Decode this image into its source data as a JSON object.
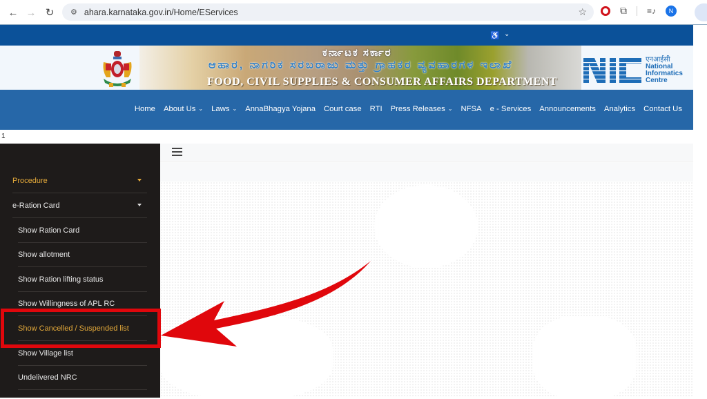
{
  "browser": {
    "url": "ahara.karnataka.gov.in/Home/EServices",
    "back_icon": "arrow-left-icon",
    "forward_icon": "arrow-right-icon",
    "reload_icon": "reload-icon",
    "site_info_icon": "tune-icon",
    "bookmark_icon": "star-icon",
    "extensions": [
      "opera-adblock-icon",
      "puzzle-icon",
      "media-control-icon"
    ],
    "profile_initial": "N"
  },
  "topbar": {
    "accessibility_icon": "accessibility-icon",
    "accessibility_glyph": "♿",
    "chevron": "⌄"
  },
  "banner": {
    "kannada_line1": "ಕರ್ನಾಟಕ ಸರ್ಕಾರ",
    "kannada_line2": "ಆಹಾರ, ನಾಗರಿಕ ಸರಬರಾಜು ಮತ್ತು ಗ್ರಾಹಕರ ವ್ಯವಹಾರಗಳ ಇಲಾಖೆ",
    "english_line": "FOOD, CIVIL SUPPLIES & CONSUMER AFFAIRS DEPARTMENT",
    "nic_hindi": "एनआईसी",
    "nic_line1": "National",
    "nic_line2": "Informatics",
    "nic_line3": "Centre"
  },
  "nav": {
    "items": [
      {
        "label": "Home",
        "dropdown": false
      },
      {
        "label": "About Us",
        "dropdown": true
      },
      {
        "label": "Laws",
        "dropdown": true
      },
      {
        "label": "AnnaBhagya Yojana",
        "dropdown": false
      },
      {
        "label": "Court case",
        "dropdown": false
      },
      {
        "label": "RTI",
        "dropdown": false
      },
      {
        "label": "Press Releases",
        "dropdown": true
      },
      {
        "label": "NFSA",
        "dropdown": false
      },
      {
        "label": "e - Services",
        "dropdown": false
      },
      {
        "label": "Announcements",
        "dropdown": false
      },
      {
        "label": "Analytics",
        "dropdown": false
      },
      {
        "label": "Contact Us",
        "dropdown": false
      }
    ],
    "chevron_glyph": "⌄"
  },
  "page_index": "1",
  "sidebar": {
    "items": [
      {
        "label": "Procedure",
        "level": 0,
        "expandable": true,
        "active": true
      },
      {
        "label": "e-Ration Card",
        "level": 0,
        "expandable": true,
        "active": false
      },
      {
        "label": "Show Ration Card",
        "level": 1,
        "expandable": false,
        "active": false
      },
      {
        "label": "Show allotment",
        "level": 1,
        "expandable": false,
        "active": false
      },
      {
        "label": "Show Ration lifting status",
        "level": 1,
        "expandable": false,
        "active": false
      },
      {
        "label": "Show Willingness of APL RC",
        "level": 1,
        "expandable": false,
        "active": false
      },
      {
        "label": "Show Cancelled / Suspended list",
        "level": 1,
        "expandable": false,
        "active": true,
        "highlighted": true
      },
      {
        "label": "Show Village list",
        "level": 1,
        "expandable": false,
        "active": false
      },
      {
        "label": "Undelivered NRC",
        "level": 1,
        "expandable": false,
        "active": false
      }
    ]
  },
  "annotation": {
    "highlight_color": "#e0070c",
    "target": "Show Cancelled / Suspended list"
  },
  "colors": {
    "top_strip": "#0b5199",
    "nav_bg": "#2667a8",
    "sidebar_bg": "#1e1b1a",
    "active_text": "#e3a93a"
  }
}
